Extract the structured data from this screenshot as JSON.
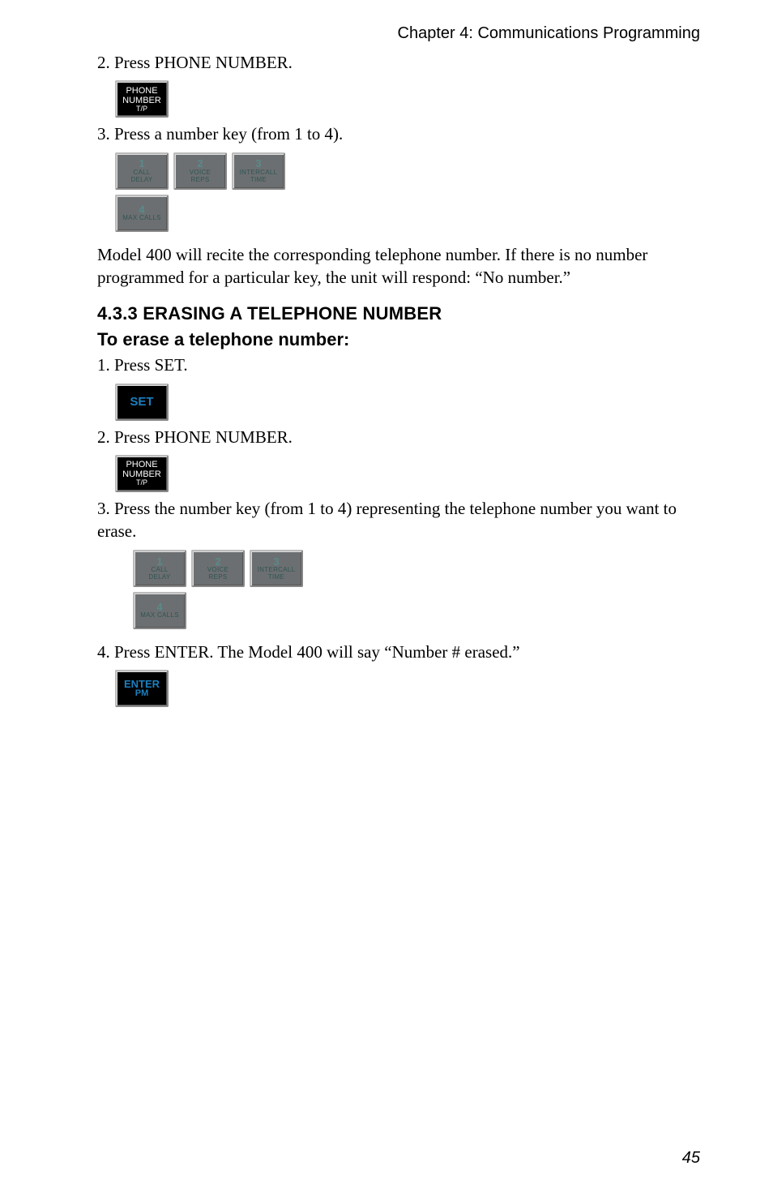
{
  "chapter": "Chapter 4: Communications Programming",
  "step2a": "2. Press PHONE NUMBER.",
  "phone_key": {
    "l1": "PHONE",
    "l2": "NUMBER",
    "l3": "T/P"
  },
  "step3a": "3. Press a number key (from 1 to 4).",
  "numkeys": [
    {
      "num": "1",
      "sub1": "CALL",
      "sub2": "DELAY"
    },
    {
      "num": "2",
      "sub1": "VOICE",
      "sub2": "REPS"
    },
    {
      "num": "3",
      "sub1": "INTERCALL",
      "sub2": "TIME"
    },
    {
      "num": "4",
      "sub1": "MAX CALLS",
      "sub2": ""
    }
  ],
  "para1": "Model 400 will recite the corresponding telephone number. If there is no number programmed for a particular key, the unit will respond: “No number.”",
  "section": "4.3.3 ERASING A TELEPHONE NUMBER",
  "subhead": "To erase a telephone number:",
  "step1b": "1. Press SET.",
  "set_label": "SET",
  "step2b": "2. Press PHONE NUMBER.",
  "step3b": "3. Press the number key (from 1 to 4) representing the telephone number you want to erase.",
  "step4b": "4. Press ENTER. The Model 400 will say “Number # erased.”",
  "enter": {
    "l1": "ENTER",
    "l2": "PM"
  },
  "page_num": "45"
}
